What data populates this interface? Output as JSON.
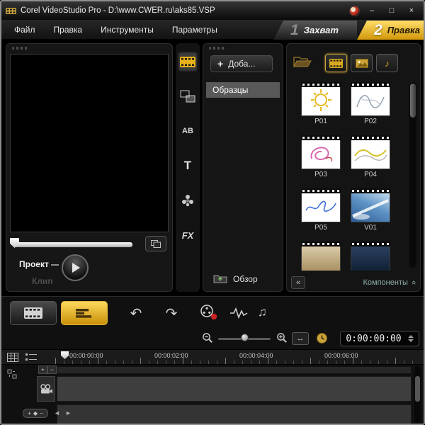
{
  "titlebar": {
    "title": "Corel VideoStudio Pro - D:\\www.CWER.ru\\aks85.VSP",
    "minimize": "–",
    "maximize": "□",
    "close": "×"
  },
  "menu": {
    "items": [
      "Файл",
      "Правка",
      "Инструменты",
      "Параметры"
    ]
  },
  "steps": {
    "capture": {
      "number": "1",
      "label": "Захват"
    },
    "edit": {
      "number": "2",
      "label": "Правка"
    }
  },
  "preview": {
    "project_label": "Проект",
    "clip_label": "Клип"
  },
  "nav": {
    "ab_label": "AB",
    "title_label": "T",
    "fx_label": "FX"
  },
  "gallery": {
    "add_label": "Доба...",
    "selected_item": "Образцы",
    "browse_label": "Обзор"
  },
  "library": {
    "thumbs": [
      {
        "label": "P01"
      },
      {
        "label": "P02"
      },
      {
        "label": "P03"
      },
      {
        "label": "P04"
      },
      {
        "label": "P05"
      },
      {
        "label": "V01"
      },
      {
        "label": ""
      },
      {
        "label": ""
      }
    ],
    "components_label": "Компоненты"
  },
  "timeline": {
    "time_display": "0:00:00:00",
    "ruler_labels": [
      "00:00:00:00",
      "00:00:02:00",
      "00:00:04:00",
      "00:00:06:00"
    ]
  },
  "icons": {
    "undo": "↶",
    "redo": "↷",
    "music_note": "♪",
    "auto_music": "♫",
    "fit": "↔",
    "collapse": "«",
    "components_chevron": "«",
    "scroll_left": "◄",
    "scroll_right": "►",
    "plus": "+",
    "minus": "−",
    "diamond": "◆",
    "add_plus": "+"
  },
  "colors": {
    "accent_gold": "#e9b21a",
    "selected_gray": "#595959"
  }
}
